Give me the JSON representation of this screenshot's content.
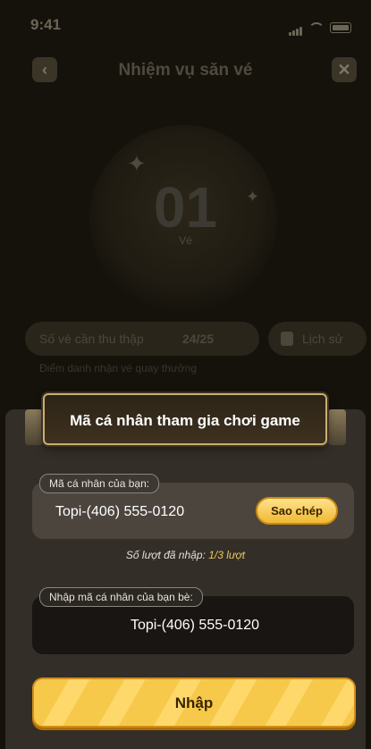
{
  "status": {
    "time": "9:41"
  },
  "nav": {
    "title": "Nhiệm vụ săn vé",
    "back_icon": "chevron-left-icon",
    "close_icon": "close-icon"
  },
  "ticket": {
    "count": "01",
    "unit": "Vé"
  },
  "collect": {
    "label": "Số vé cần thu thập",
    "count": "24/25"
  },
  "history": {
    "label": "Lịch sử"
  },
  "checkin": {
    "text": "Điểm danh nhận vé quay thưởng"
  },
  "modal": {
    "title": "Mã cá nhân tham gia chơi game",
    "personal_label": "Mã cá nhân của bạn:",
    "personal_code": "Topi-(406) 555-0120",
    "copy_label": "Sao chép",
    "entered_prefix": "Số lượt đã nhập:",
    "entered_count": "1/3 lượt",
    "friend_label": "Nhập mã cá nhân của bạn bè:",
    "friend_value": "Topi-(406) 555-0120",
    "submit_label": "Nhập"
  },
  "colors": {
    "accent": "#f6c94b",
    "sheet": "#332e28",
    "card": "#4b453e",
    "input": "#181512"
  }
}
